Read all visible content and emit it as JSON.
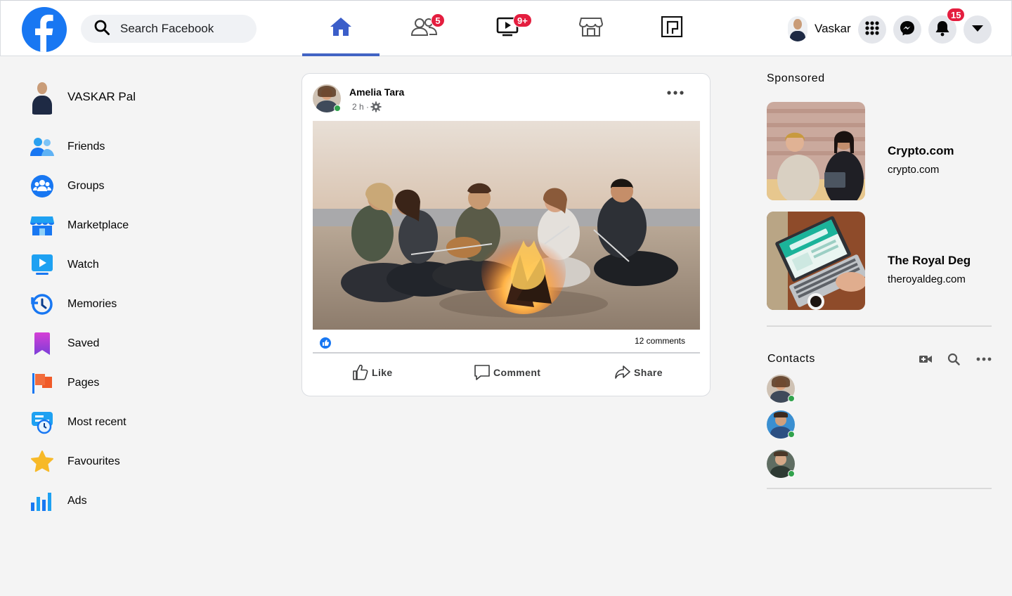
{
  "header": {
    "logo_icon": "facebook-logo-icon",
    "search_placeholder": "Search Facebook",
    "tabs": [
      {
        "name": "home",
        "icon": "home-icon",
        "active": true,
        "badge": ""
      },
      {
        "name": "friends",
        "icon": "friends-icon",
        "active": false,
        "badge": "5"
      },
      {
        "name": "watch",
        "icon": "watch-icon",
        "active": false,
        "badge": "9+"
      },
      {
        "name": "marketplace",
        "icon": "marketplace-icon",
        "active": false,
        "badge": ""
      },
      {
        "name": "gaming",
        "icon": "gaming-icon",
        "active": false,
        "badge": ""
      }
    ],
    "profile_name": "Vaskar",
    "notification_count": "15",
    "buttons": [
      "menu-grid-icon",
      "messenger-icon",
      "bell-icon",
      "caret-down-icon"
    ]
  },
  "sidebar": {
    "user_name": "VASKAR Pal",
    "items": [
      {
        "label": "Friends",
        "icon": "friends-icon"
      },
      {
        "label": "Groups",
        "icon": "groups-icon"
      },
      {
        "label": "Marketplace",
        "icon": "marketplace-icon"
      },
      {
        "label": "Watch",
        "icon": "watch-icon"
      },
      {
        "label": "Memories",
        "icon": "memories-icon"
      },
      {
        "label": "Saved",
        "icon": "saved-icon"
      },
      {
        "label": "Pages",
        "icon": "pages-icon"
      },
      {
        "label": "Most recent",
        "icon": "most-recent-icon"
      },
      {
        "label": "Favourites",
        "icon": "favourites-icon"
      },
      {
        "label": "Ads",
        "icon": "ads-icon"
      }
    ]
  },
  "post": {
    "author": "Amelia Tara",
    "time": "2 h ·",
    "privacy_icon": "gear-icon",
    "image_alt": "photo",
    "reaction_icon": "like-reaction-icon",
    "comments": "12 comments",
    "actions": {
      "like": "Like",
      "comment": "Comment",
      "share": "Share"
    }
  },
  "right": {
    "sponsored_title": "Sponsored",
    "ads": [
      {
        "title": "Crypto.com",
        "site": "crypto.com"
      },
      {
        "title": "The Royal Deg",
        "site": "theroyaldeg.com"
      }
    ],
    "contacts_title": "Contacts",
    "contact_tools": [
      "video-call-icon",
      "search-icon",
      "more-icon"
    ],
    "contacts_online": [
      true,
      true,
      true
    ]
  },
  "colors": {
    "brand": "#1877f2",
    "active_tab": "#4264c4",
    "badge": "#e41e3f",
    "online": "#31a24c",
    "background": "#f4f4f4"
  }
}
